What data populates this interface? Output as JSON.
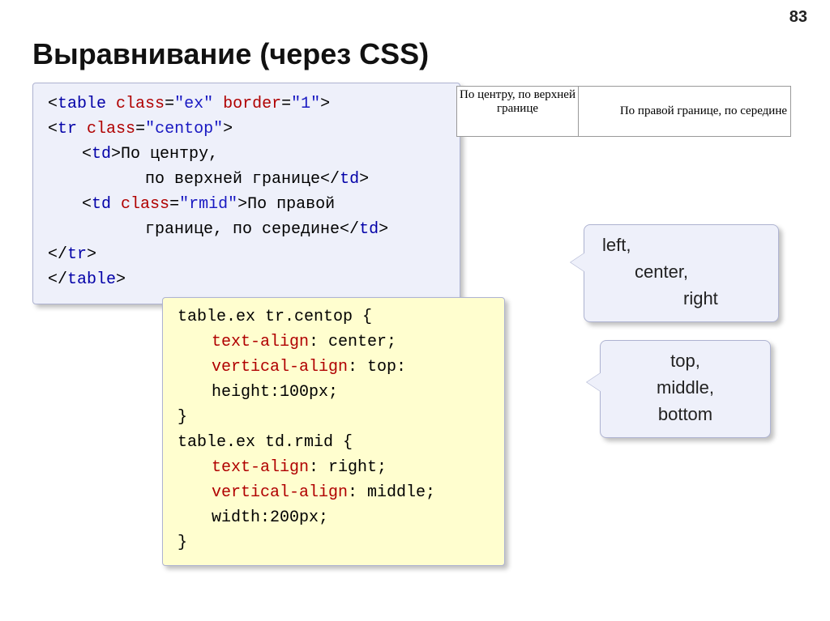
{
  "page_number": "83",
  "title": "Выравнивание (через CSS)",
  "html_code": {
    "l1_tag": "table",
    "l1_attr1": "class",
    "l1_val1": "\"ex\"",
    "l1_attr2": "border",
    "l1_val2": "\"1\"",
    "l2_tag": "tr",
    "l2_attr": "class",
    "l2_val": "\"centop\"",
    "l3_tag": "td",
    "l3_text_a": "По центру,",
    "l4_text": "по верхней границе",
    "l4_tag_close": "td",
    "l5_tag": "td",
    "l5_attr": "class",
    "l5_val": "\"rmid\"",
    "l5_text_a": "По правой",
    "l6_text": "границе, по середине",
    "l6_tag_close": "td",
    "l7_tag": "tr",
    "l8_tag": "table"
  },
  "css_code": {
    "sel1": "table.ex tr.centop {",
    "p1a": "text-align",
    "v1a": "center;",
    "p1b": "vertical-align",
    "v1b": "top:",
    "p1c": "height:100px;",
    "close1": "}",
    "sel2": "table.ex td.rmid {",
    "p2a": "text-align",
    "v2a": "right;",
    "p2b": "vertical-align",
    "v2b": "middle;",
    "p2c": "width:200px;",
    "close2": "}"
  },
  "demo": {
    "cell1": "По центру, по верхней границе",
    "cell2": "По правой границе, по середине"
  },
  "callout1": {
    "a": "left,",
    "b": "center,",
    "c": "right"
  },
  "callout2": {
    "a": "top,",
    "b": "middle,",
    "c": "bottom"
  }
}
